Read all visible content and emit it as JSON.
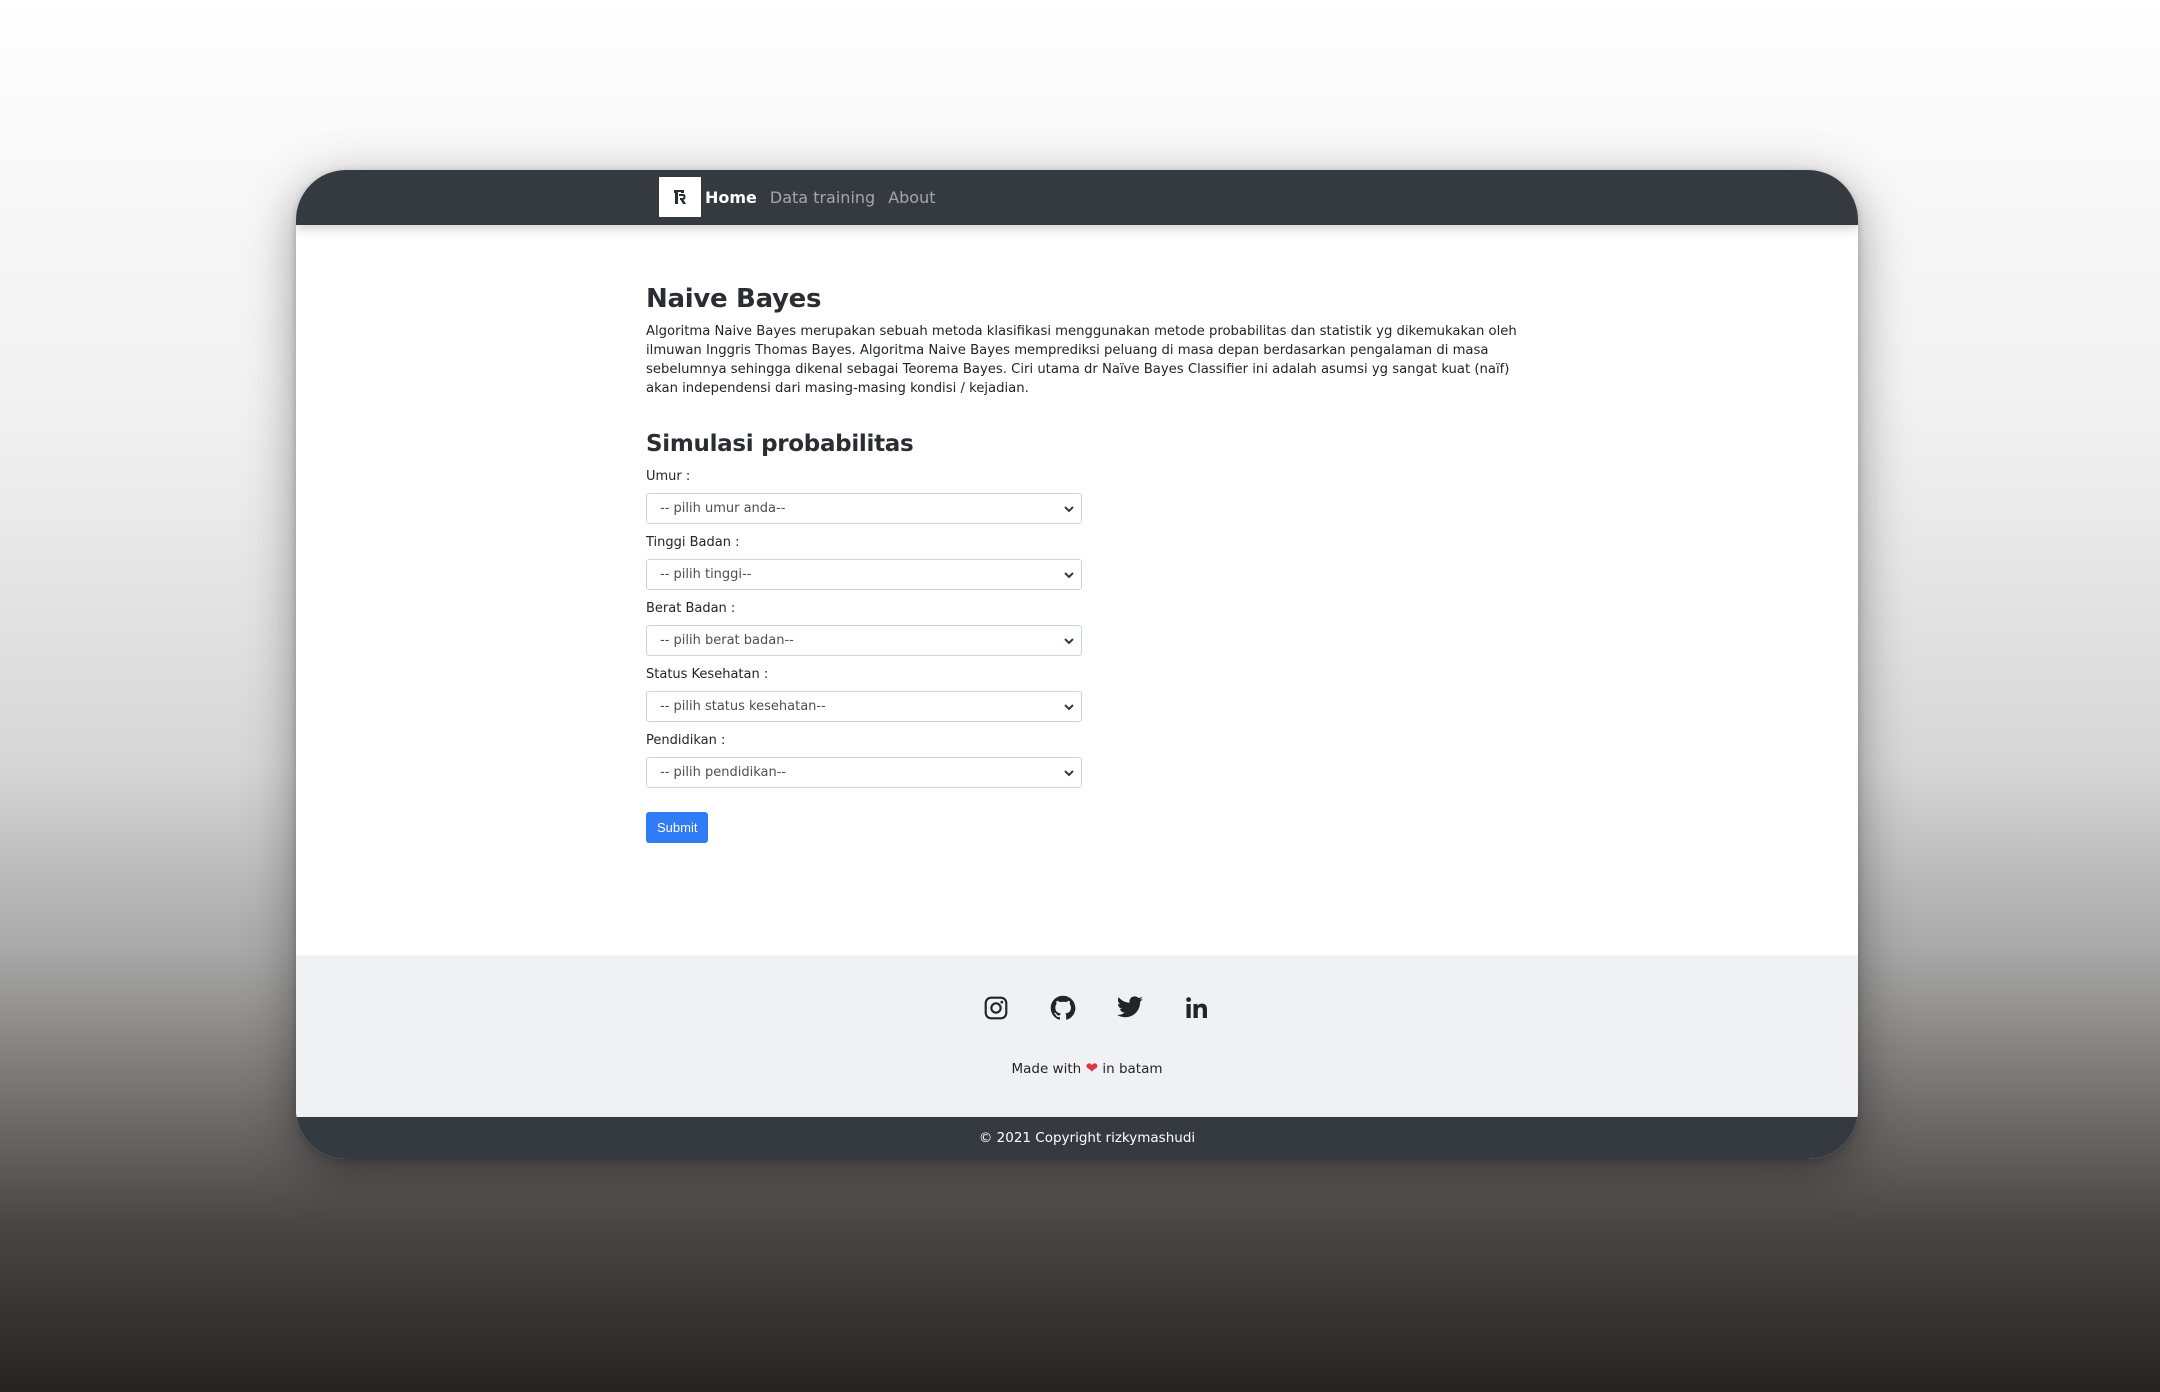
{
  "navbar": {
    "brand_icon": "logo-r-icon",
    "links": [
      {
        "label": "Home",
        "active": true
      },
      {
        "label": "Data training",
        "active": false
      },
      {
        "label": "About",
        "active": false
      }
    ]
  },
  "main": {
    "title": "Naive Bayes",
    "description": "Algoritma Naive Bayes merupakan sebuah metoda klasifikasi menggunakan metode probabilitas dan statistik yg dikemukakan oleh ilmuwan Inggris Thomas Bayes. Algoritma Naive Bayes memprediksi peluang di masa depan berdasarkan pengalaman di masa sebelumnya sehingga dikenal sebagai Teorema Bayes. Ciri utama dr Naïve Bayes Classifier ini adalah asumsi yg sangat kuat (naïf) akan independensi dari masing-masing kondisi / kejadian.",
    "form_title": "Simulasi probabilitas",
    "fields": [
      {
        "label": "Umur :",
        "selected": "-- pilih umur anda--"
      },
      {
        "label": "Tinggi Badan :",
        "selected": "-- pilih tinggi--"
      },
      {
        "label": "Berat Badan :",
        "selected": "-- pilih berat badan--"
      },
      {
        "label": "Status Kesehatan :",
        "selected": "-- pilih status kesehatan--"
      },
      {
        "label": "Pendidikan :",
        "selected": "-- pilih pendidikan--"
      }
    ],
    "submit_label": "Submit"
  },
  "footer": {
    "social_icons": [
      "instagram-icon",
      "github-icon",
      "twitter-icon",
      "linkedin-icon"
    ],
    "made_with_prefix": "Made with",
    "heart": "❤",
    "made_with_suffix": "in batam",
    "copyright": "© 2021 Copyright rizkymashudi"
  },
  "colors": {
    "navbar_bg": "#343a40",
    "primary_button": "#2f7cf6",
    "footer_bg": "#f0f1f3",
    "heart": "#dc3545"
  }
}
